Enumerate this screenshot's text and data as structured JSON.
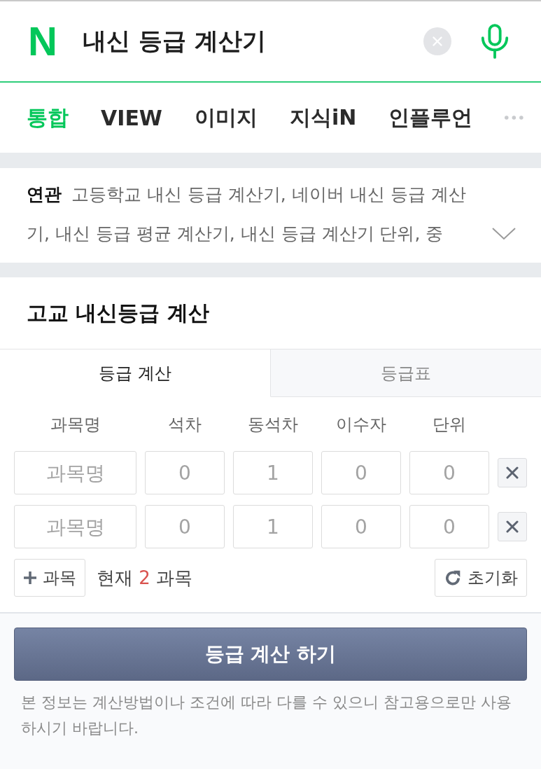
{
  "search": {
    "logo": "N",
    "query": "내신 등급 계산기"
  },
  "tabs": [
    {
      "label": "통합",
      "selected": true
    },
    {
      "label": "VIEW",
      "selected": false
    },
    {
      "label": "이미지",
      "selected": false
    },
    {
      "label": "지식iN",
      "selected": false
    },
    {
      "label": "인플루언",
      "selected": false
    }
  ],
  "related": {
    "label": "연관",
    "text": "고등학교 내신 등급 계산기, 네이버 내신 등급 계산기, 내신 등급 평균 계산기, 내신 등급 계산기 단위, 중",
    "expanded": false
  },
  "calculator": {
    "title": "고교 내신등급 계산",
    "tabs": [
      {
        "label": "등급 계산",
        "selected": true
      },
      {
        "label": "등급표",
        "selected": false
      }
    ],
    "columns": [
      "과목명",
      "석차",
      "동석차",
      "이수자",
      "단위"
    ],
    "rows": [
      {
        "fields": [
          {
            "placeholder": "과목명"
          },
          {
            "placeholder": "0"
          },
          {
            "placeholder": "1"
          },
          {
            "placeholder": "0"
          },
          {
            "placeholder": "0"
          }
        ]
      },
      {
        "fields": [
          {
            "placeholder": "과목명"
          },
          {
            "placeholder": "0"
          },
          {
            "placeholder": "1"
          },
          {
            "placeholder": "0"
          },
          {
            "placeholder": "0"
          }
        ]
      }
    ],
    "add_button": "과목",
    "count": {
      "prefix": "현재",
      "value": "2",
      "suffix": "과목"
    },
    "reset_button": "초기화",
    "submit_button": "등급 계산 하기",
    "disclaimer": "본 정보는 계산방법이나 조건에 따라 다를 수 있으니 참고용으로만 사용하시기 바랍니다."
  }
}
